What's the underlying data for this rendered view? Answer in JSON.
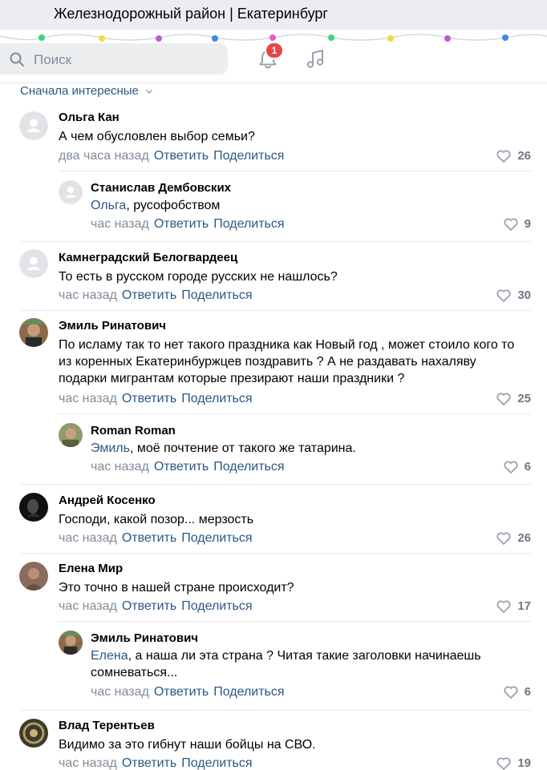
{
  "window": {
    "title": "Железнодорожный район | Екатеринбург"
  },
  "header": {
    "search_placeholder": "Поиск",
    "notifications_count": "1"
  },
  "sort_label": "Сначала интересные",
  "actions": {
    "reply": "Ответить",
    "share": "Поделиться"
  },
  "colors": {
    "accent": "#2a5885",
    "meta": "#818c99",
    "badge": "#e64646"
  },
  "comments": [
    {
      "author": "Ольга Кан",
      "text": "А чем обусловлен выбор семьи?",
      "mention": "",
      "time": "два часа назад",
      "likes": "26",
      "avatar": "placeholder"
    },
    {
      "author": "Станислав Дембовских",
      "mention": "Ольга",
      "text": ", русофобством",
      "time": "час назад",
      "likes": "9",
      "avatar": "placeholder"
    },
    {
      "author": "Камнеградский Белогвардеец",
      "text": "То есть в русском городе русских не нашлось?",
      "mention": "",
      "time": "час назад",
      "likes": "30",
      "avatar": "placeholder"
    },
    {
      "author": "Эмиль Ринатович",
      "text": "По исламу так то нет такого праздника как Новый год , может стоило кого то из коренных Екатеринбуржцев поздравить ? А не раздавать нахаляву подарки мигрантам которые презирают наши праздники ?",
      "mention": "",
      "time": "час назад",
      "likes": "25",
      "avatar": "photo"
    },
    {
      "author": "Roman Roman",
      "mention": "Эмиль",
      "text": ", моё почтение от такого же татарина.",
      "time": "час назад",
      "likes": "6",
      "avatar": "photo"
    },
    {
      "author": "Андрей Косенко",
      "text": "Господи, какой позор... мерзость",
      "mention": "",
      "time": "час назад",
      "likes": "26",
      "avatar": "photo"
    },
    {
      "author": "Елена Мир",
      "text": "Это точно в нашей стране происходит?",
      "mention": "",
      "time": "час назад",
      "likes": "17",
      "avatar": "photo"
    },
    {
      "author": "Эмиль Ринатович",
      "mention": "Елена",
      "text": ", а наша ли эта страна ? Читая такие заголовки начинаешь сомневаться...",
      "time": "час назад",
      "likes": "6",
      "avatar": "photo"
    },
    {
      "author": "Влад Терентьев",
      "text": "Видимо за это гибнут наши бойцы на СВО.",
      "mention": "",
      "time": "час назад",
      "likes": "19",
      "avatar": "photo"
    }
  ]
}
